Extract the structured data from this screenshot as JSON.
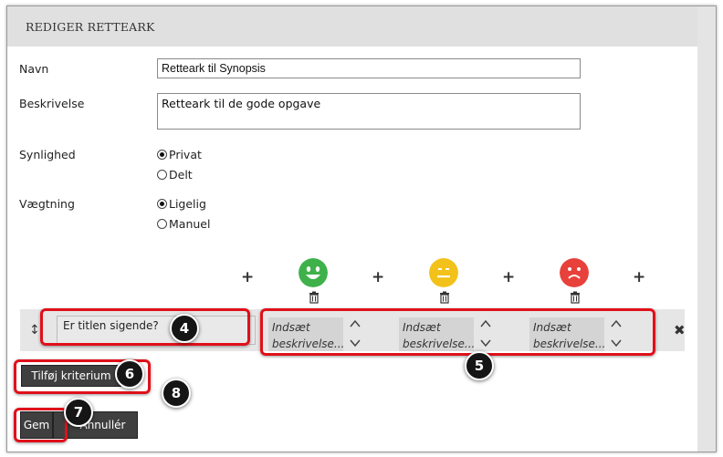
{
  "header": {
    "title": "REDIGER RETTEARK"
  },
  "form": {
    "name_label": "Navn",
    "name_value": "Retteark til Synopsis",
    "description_label": "Beskrivelse",
    "description_value": "Retteark  til de gode opgave",
    "visibility_label": "Synlighed",
    "visibility_options": [
      {
        "label": "Privat",
        "checked": true
      },
      {
        "label": "Delt",
        "checked": false
      }
    ],
    "weighting_label": "Vægtning",
    "weighting_options": [
      {
        "label": "Ligelig",
        "checked": true
      },
      {
        "label": "Manuel",
        "checked": false
      }
    ]
  },
  "levels": [
    {
      "face": "happy-face-icon",
      "color": "#3fb14a"
    },
    {
      "face": "neutral-face-icon",
      "color": "#f2c21a"
    },
    {
      "face": "sad-face-icon",
      "color": "#e8403a"
    }
  ],
  "criterion": {
    "text": "Er titlen sigende?",
    "level_placeholders": [
      "Indsæt beskrivelse...",
      "Indsæt beskrivelse...",
      "Indsæt beskrivelse..."
    ]
  },
  "buttons": {
    "add_criterion": "Tilføj kriterium",
    "save": "Gem",
    "cancel": "Annullér"
  },
  "steps": [
    "4",
    "5",
    "6",
    "7",
    "8"
  ],
  "colors": {
    "highlight": "#e0101a",
    "dark_button": "#3f3f3f"
  }
}
